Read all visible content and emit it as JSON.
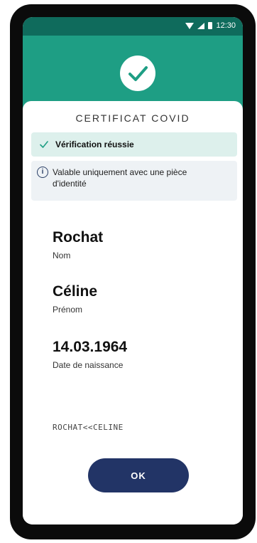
{
  "status_bar": {
    "time": "12:30",
    "icons": [
      "wifi-icon",
      "signal-icon",
      "battery-icon"
    ]
  },
  "header": {
    "icon": "check-icon",
    "color": "#1e9e84"
  },
  "card": {
    "title": "CERTIFICAT COVID",
    "success_banner": {
      "icon": "check-icon",
      "text": "Vérification réussie",
      "color": "#ddf0ec"
    },
    "info_banner": {
      "icon": "info-icon",
      "text": "Valable uniquement avec une pièce d'identité"
    },
    "fields": {
      "surname": {
        "value": "Rochat",
        "label": "Nom"
      },
      "given_name": {
        "value": "Céline",
        "label": "Prénom"
      },
      "birth_date": {
        "value": "14.03.1964",
        "label": "Date de naissance"
      }
    },
    "mrz": "ROCHAT<<CELINE",
    "ok_button": {
      "label": "OK",
      "color": "#223466"
    }
  }
}
